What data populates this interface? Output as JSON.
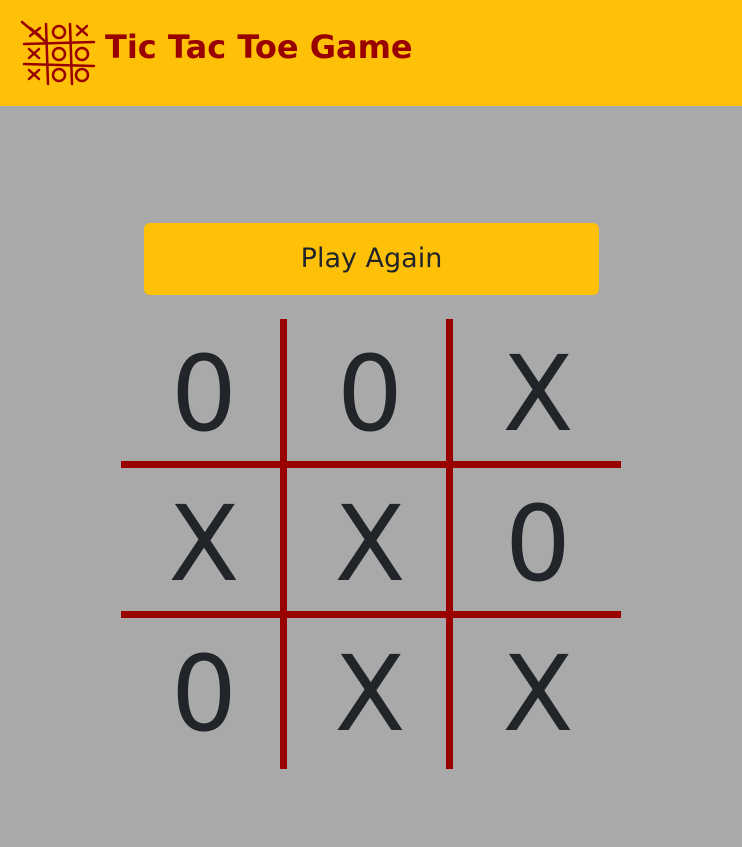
{
  "header": {
    "title": "Tic Tac Toe Game",
    "logo_icon": "tic-tac-toe-logo-icon",
    "background_color": "#ffc107",
    "title_color": "#990000"
  },
  "actions": {
    "play_again_label": "Play Again"
  },
  "board": {
    "line_color": "#990000",
    "cells": [
      "0",
      "0",
      "X",
      "X",
      "X",
      "0",
      "0",
      "X",
      "X"
    ]
  },
  "page": {
    "background_color": "#a9a9a9"
  }
}
